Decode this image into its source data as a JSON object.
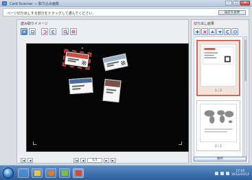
{
  "window": {
    "title": "Card Scanner — 取り込み画像",
    "controls": [
      "–",
      "□",
      "×"
    ]
  },
  "instruction": {
    "text": "ページ切り出しする部分をドラッグして選んでください。",
    "action_label": "設定を変更"
  },
  "left_panel": {
    "heading": "読み取りイメージ",
    "toolbar": [
      "select-tool-icon",
      "image-tool-icon",
      "rotate-left-icon",
      "rotate-right-icon",
      "zoom-in-icon",
      "zoom-out-icon"
    ],
    "page_field": "1/1",
    "nav": {
      "first": "|◀",
      "prev": "◀",
      "next": "▶",
      "last": "▶|"
    }
  },
  "right_panel": {
    "heading": "切り出し結果",
    "toolbar": [
      "add-icon",
      "delete-icon",
      "up-icon",
      "down-icon",
      "rotate-icon",
      "settings-icon"
    ],
    "thumbs": [
      {
        "label": "1 / 2"
      },
      {
        "label": "2 / 2"
      }
    ],
    "bottom_button": "保存"
  },
  "cards": [
    {
      "stripe": "#c85040",
      "selected": true
    },
    {
      "stripe": "#9ab0c8",
      "selected": false
    },
    {
      "stripe": "#7a5048",
      "selected": false
    },
    {
      "stripe": "#4a6a9a",
      "selected": false
    }
  ],
  "taskbar": {
    "apps": [
      "ie-icon",
      "explorer-icon",
      "media-icon",
      "app-icon",
      "scanner-icon"
    ],
    "clock_time": "17:45",
    "clock_date": "2012/10/12"
  },
  "colors": {
    "accent": "#2c5d9b",
    "selection": "#c96a5a",
    "canvas": "#050505"
  }
}
